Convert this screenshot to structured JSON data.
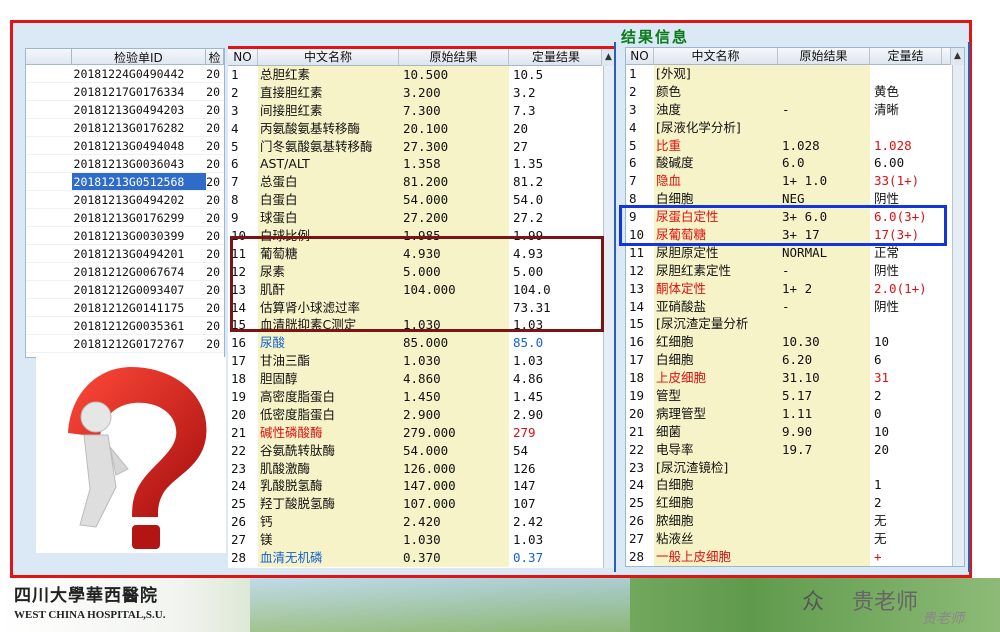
{
  "title": "结果信息",
  "left_grid": {
    "headers": [
      "",
      "检验单ID",
      "检"
    ],
    "rows": [
      {
        "id": "20181224G0490442",
        "tail": "20"
      },
      {
        "id": "20181217G0176334",
        "tail": "20"
      },
      {
        "id": "20181213G0494203",
        "tail": "20"
      },
      {
        "id": "20181213G0176282",
        "tail": "20"
      },
      {
        "id": "20181213G0494048",
        "tail": "20"
      },
      {
        "id": "20181213G0036043",
        "tail": "20"
      },
      {
        "id": "20181213G0512568",
        "tail": "20",
        "selected": true
      },
      {
        "id": "20181213G0494202",
        "tail": "20"
      },
      {
        "id": "20181213G0176299",
        "tail": "20"
      },
      {
        "id": "20181213G0030399",
        "tail": "20"
      },
      {
        "id": "20181213G0494201",
        "tail": "20"
      },
      {
        "id": "20181212G0067674",
        "tail": "20"
      },
      {
        "id": "20181212G0093407",
        "tail": "20"
      },
      {
        "id": "20181212G0141175",
        "tail": "20"
      },
      {
        "id": "20181212G0035361",
        "tail": "20"
      },
      {
        "id": "20181212G0172767",
        "tail": "20"
      }
    ]
  },
  "mid_grid": {
    "headers": [
      "NO",
      "中文名称",
      "原始结果",
      "定量结果"
    ],
    "rows": [
      {
        "no": "1",
        "name": "总胆红素",
        "raw": "10.500",
        "quant": "10.5",
        "status": ""
      },
      {
        "no": "2",
        "name": "直接胆红素",
        "raw": "3.200",
        "quant": "3.2",
        "status": ""
      },
      {
        "no": "3",
        "name": "间接胆红素",
        "raw": "7.300",
        "quant": "7.3",
        "status": ""
      },
      {
        "no": "4",
        "name": "丙氨酸氨基转移酶",
        "raw": "20.100",
        "quant": "20",
        "status": ""
      },
      {
        "no": "5",
        "name": "门冬氨酸氨基转移酶",
        "raw": "27.300",
        "quant": "27",
        "status": ""
      },
      {
        "no": "6",
        "name": "AST/ALT",
        "raw": "1.358",
        "quant": "1.35",
        "status": ""
      },
      {
        "no": "7",
        "name": "总蛋白",
        "raw": "81.200",
        "quant": "81.2",
        "status": ""
      },
      {
        "no": "8",
        "name": "白蛋白",
        "raw": "54.000",
        "quant": "54.0",
        "status": ""
      },
      {
        "no": "9",
        "name": "球蛋白",
        "raw": "27.200",
        "quant": "27.2",
        "status": ""
      },
      {
        "no": "10",
        "name": "白球比例",
        "raw": "1.985",
        "quant": "1.99",
        "status": ""
      },
      {
        "no": "11",
        "name": "葡萄糖",
        "raw": "4.930",
        "quant": "4.93",
        "status": ""
      },
      {
        "no": "12",
        "name": "尿素",
        "raw": "5.000",
        "quant": "5.00",
        "status": ""
      },
      {
        "no": "13",
        "name": "肌酐",
        "raw": "104.000",
        "quant": "104.0",
        "status": ""
      },
      {
        "no": "14",
        "name": "估算肾小球滤过率",
        "raw": "",
        "quant": "73.31",
        "status": ""
      },
      {
        "no": "15",
        "name": "血清胱抑素C测定",
        "raw": "1.030",
        "quant": "1.03",
        "status": ""
      },
      {
        "no": "16",
        "name": "尿酸",
        "raw": "85.000",
        "quant": "85.0",
        "status": "low"
      },
      {
        "no": "17",
        "name": "甘油三酯",
        "raw": "1.030",
        "quant": "1.03",
        "status": ""
      },
      {
        "no": "18",
        "name": "胆固醇",
        "raw": "4.860",
        "quant": "4.86",
        "status": ""
      },
      {
        "no": "19",
        "name": "高密度脂蛋白",
        "raw": "1.450",
        "quant": "1.45",
        "status": ""
      },
      {
        "no": "20",
        "name": "低密度脂蛋白",
        "raw": "2.900",
        "quant": "2.90",
        "status": ""
      },
      {
        "no": "21",
        "name": "碱性磷酸酶",
        "raw": "279.000",
        "quant": "279",
        "status": "high"
      },
      {
        "no": "22",
        "name": "谷氨酰转肽酶",
        "raw": "54.000",
        "quant": "54",
        "status": ""
      },
      {
        "no": "23",
        "name": "肌酸激酶",
        "raw": "126.000",
        "quant": "126",
        "status": ""
      },
      {
        "no": "24",
        "name": "乳酸脱氢酶",
        "raw": "147.000",
        "quant": "147",
        "status": ""
      },
      {
        "no": "25",
        "name": "羟丁酸脱氢酶",
        "raw": "107.000",
        "quant": "107",
        "status": ""
      },
      {
        "no": "26",
        "name": "钙",
        "raw": "2.420",
        "quant": "2.42",
        "status": ""
      },
      {
        "no": "27",
        "name": "镁",
        "raw": "1.030",
        "quant": "1.03",
        "status": ""
      },
      {
        "no": "28",
        "name": "血清无机磷",
        "raw": "0.370",
        "quant": "0.37",
        "status": "low"
      }
    ]
  },
  "right_grid": {
    "headers": [
      "NO",
      "中文名称",
      "原始结果",
      "定量结"
    ],
    "rows": [
      {
        "no": "1",
        "name": "[外观]",
        "raw": "",
        "quant": "",
        "status": ""
      },
      {
        "no": "2",
        "name": "颜色",
        "raw": "",
        "quant": "黄色",
        "status": ""
      },
      {
        "no": "3",
        "name": "浊度",
        "raw": "-",
        "quant": "清晰",
        "status": ""
      },
      {
        "no": "4",
        "name": "[尿液化学分析]",
        "raw": "",
        "quant": "",
        "status": ""
      },
      {
        "no": "5",
        "name": "比重",
        "raw": "1.028",
        "quant": "1.028",
        "status": "high"
      },
      {
        "no": "6",
        "name": "酸碱度",
        "raw": "6.0",
        "quant": "6.00",
        "status": ""
      },
      {
        "no": "7",
        "name": "隐血",
        "raw": "1+      1.0",
        "quant": "33(1+)",
        "status": "high"
      },
      {
        "no": "8",
        "name": "白细胞",
        "raw": "NEG",
        "quant": "阴性",
        "status": ""
      },
      {
        "no": "9",
        "name": "尿蛋白定性",
        "raw": "3+     6.0",
        "quant": "6.0(3+)",
        "status": "high"
      },
      {
        "no": "10",
        "name": "尿葡萄糖",
        "raw": "3+     17",
        "quant": "17(3+)",
        "status": "high"
      },
      {
        "no": "11",
        "name": "尿胆原定性",
        "raw": "NORMAL",
        "quant": "正常",
        "status": ""
      },
      {
        "no": "12",
        "name": "尿胆红素定性",
        "raw": "-",
        "quant": "阴性",
        "status": ""
      },
      {
        "no": "13",
        "name": "酮体定性",
        "raw": "1+     2",
        "quant": "2.0(1+)",
        "status": "high"
      },
      {
        "no": "14",
        "name": "亚硝酸盐",
        "raw": "-",
        "quant": "阴性",
        "status": ""
      },
      {
        "no": "15",
        "name": "[尿沉渣定量分析",
        "raw": "",
        "quant": "",
        "status": ""
      },
      {
        "no": "16",
        "name": "红细胞",
        "raw": "10.30",
        "quant": "10",
        "status": ""
      },
      {
        "no": "17",
        "name": "白细胞",
        "raw": "6.20",
        "quant": "6",
        "status": ""
      },
      {
        "no": "18",
        "name": "上皮细胞",
        "raw": "31.10",
        "quant": "31",
        "status": "high"
      },
      {
        "no": "19",
        "name": "管型",
        "raw": "5.17",
        "quant": "2",
        "status": ""
      },
      {
        "no": "20",
        "name": "病理管型",
        "raw": "1.11",
        "quant": "0",
        "status": ""
      },
      {
        "no": "21",
        "name": "细菌",
        "raw": "9.90",
        "quant": "10",
        "status": ""
      },
      {
        "no": "22",
        "name": "电导率",
        "raw": "19.7",
        "quant": "20",
        "status": ""
      },
      {
        "no": "23",
        "name": "[尿沉渣镜检]",
        "raw": "",
        "quant": "",
        "status": ""
      },
      {
        "no": "24",
        "name": "白细胞",
        "raw": "",
        "quant": "1",
        "status": ""
      },
      {
        "no": "25",
        "name": "红细胞",
        "raw": "",
        "quant": "2",
        "status": ""
      },
      {
        "no": "26",
        "name": "脓细胞",
        "raw": "",
        "quant": "无",
        "status": ""
      },
      {
        "no": "27",
        "name": "粘液丝",
        "raw": "",
        "quant": "无",
        "status": ""
      },
      {
        "no": "28",
        "name": "一般上皮细胞",
        "raw": "",
        "quant": "+",
        "status": "high"
      }
    ]
  },
  "footer": {
    "hospital_cn": "四川大學華西醫院",
    "hospital_en": "WEST CHINA HOSPITAL,S.U.",
    "teacher_prefix": "众",
    "teacher": "贵老师",
    "teacher_signature": "贵老师"
  },
  "icons": [
    "scroll-up-icon",
    "question-figure-icon"
  ],
  "colors": {
    "abnormal_high": "#e01010",
    "abnormal_low": "#1560d6",
    "frame_red": "#e01515",
    "frame_blue": "#1136e0",
    "title_green": "#0a7a1a"
  }
}
